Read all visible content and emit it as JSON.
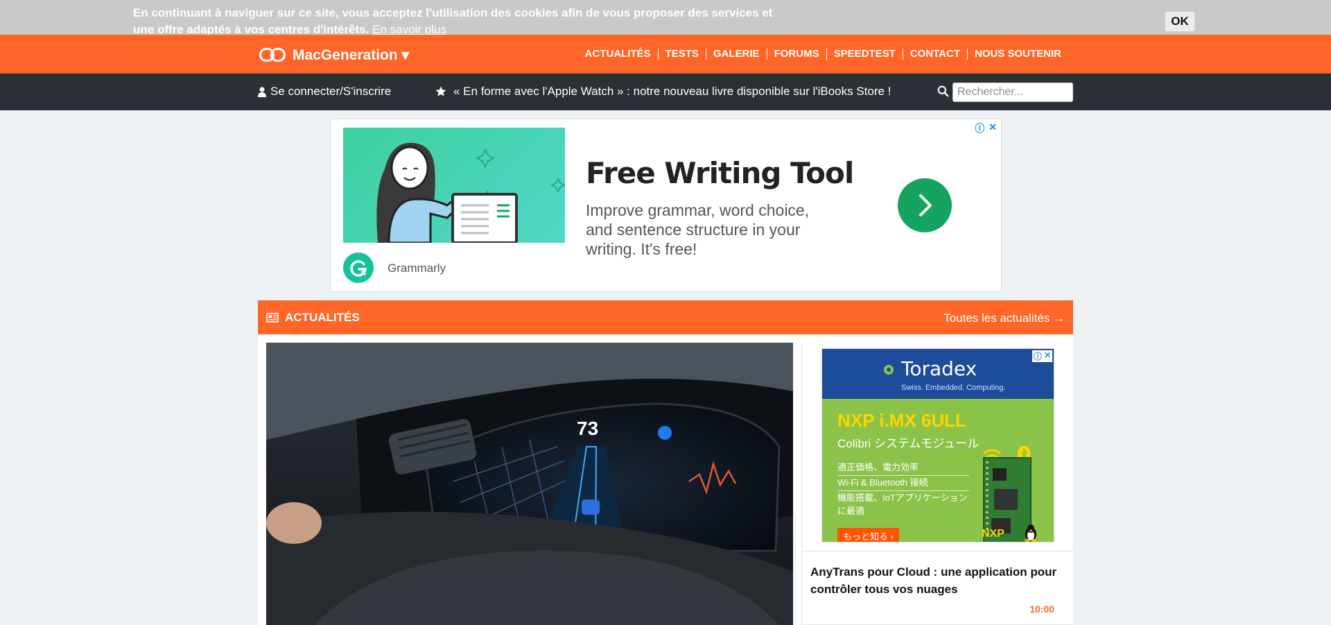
{
  "cookie": {
    "text": "En continuant à naviguer sur ce site, vous acceptez l'utilisation des cookies afin de vous proposer des services et une offre adaptés à vos centres d'intérêts.",
    "link": "En savoir plus",
    "ok": "OK"
  },
  "header": {
    "logo": "MacGeneration ▾",
    "nav": [
      "ACTUALITÉS",
      "TESTS",
      "GALERIE",
      "FORUMS",
      "SPEEDTEST",
      "CONTACT",
      "NOUS SOUTENIR"
    ]
  },
  "subbar": {
    "login": "Se connecter/S'inscrire",
    "promo": "« En forme avec l'Apple Watch » : notre nouveau livre disponible sur l'iBooks Store !",
    "search_placeholder": "Rechercher..."
  },
  "ad_grammarly": {
    "title": "Free Writing Tool",
    "description": "Improve grammar, word choice, and sentence structure in your writing. It's free!",
    "brand": "Grammarly"
  },
  "news": {
    "title": "ACTUALITÉS",
    "all_link": "Toutes les actualités →"
  },
  "ad_toradex": {
    "brand": "Toradex",
    "tagline": "Swiss. Embedded. Computing.",
    "product": "NXP i.MX 6ULL",
    "subtitle": "Colibri システムモジュール",
    "lines": [
      "適正価格、電力効率",
      "Wi-Fi & Bluetooth 接続",
      "機能搭載、IoTアプリケーションに最適"
    ],
    "more": "もっと知る ›",
    "partner": "NXP"
  },
  "side_article": {
    "title": "AnyTrans pour Cloud : une application pour contrôler tous vos nuages",
    "time": "10:00"
  },
  "colors": {
    "accent": "#ff6628",
    "dark_bar": "#2a3035",
    "background": "#eef2f5"
  }
}
